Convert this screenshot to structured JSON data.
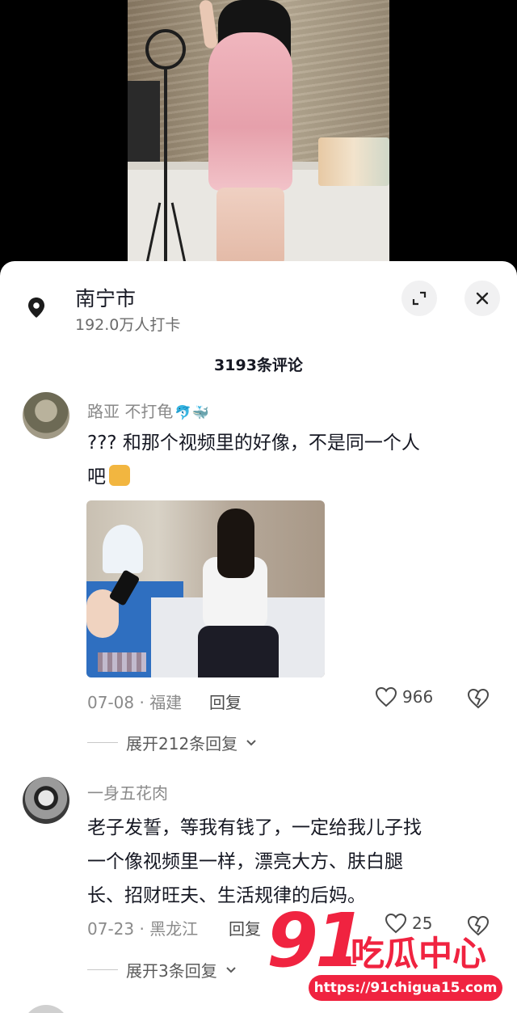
{
  "location": {
    "title": "南宁市",
    "subtitle": "192.0万人打卡"
  },
  "comments_header": {
    "count_label": "3193条评论"
  },
  "comments": [
    {
      "username": "路亚 不打龟",
      "username_emoji": "🐬🐳",
      "text_line1": "??? 和那个视频里的好像，不是同一个人",
      "text_line2": "吧",
      "has_image": true,
      "date_place": "07-08 · 福建",
      "reply_label": "回复",
      "likes": "966",
      "expand_label": "展开212条回复"
    },
    {
      "username": "一身五花肉",
      "text_line1": "老子发誓，等我有钱了，一定给我儿子找",
      "text_line2": "一个像视频里一样，漂亮大方、肤白腿",
      "text_line3": "长、招财旺夫、生活规律的后妈。",
      "date_place": "07-23 · 黑龙江",
      "reply_label": "回复",
      "likes": "25",
      "expand_label": "展开3条回复"
    }
  ],
  "watermark": {
    "number": "91",
    "brand": "吃瓜中心",
    "url": "https://91chigua15.com"
  },
  "icons": {
    "location": "location-pin-icon",
    "expand": "expand-icon",
    "close": "close-icon",
    "like": "heart-outline-icon",
    "dislike": "broken-heart-icon",
    "chevron": "chevron-down-icon"
  },
  "colors": {
    "sheet_bg": "#ffffff",
    "text_primary": "#161823",
    "text_secondary": "#8a8a8a",
    "watermark_red": "#f02340"
  }
}
